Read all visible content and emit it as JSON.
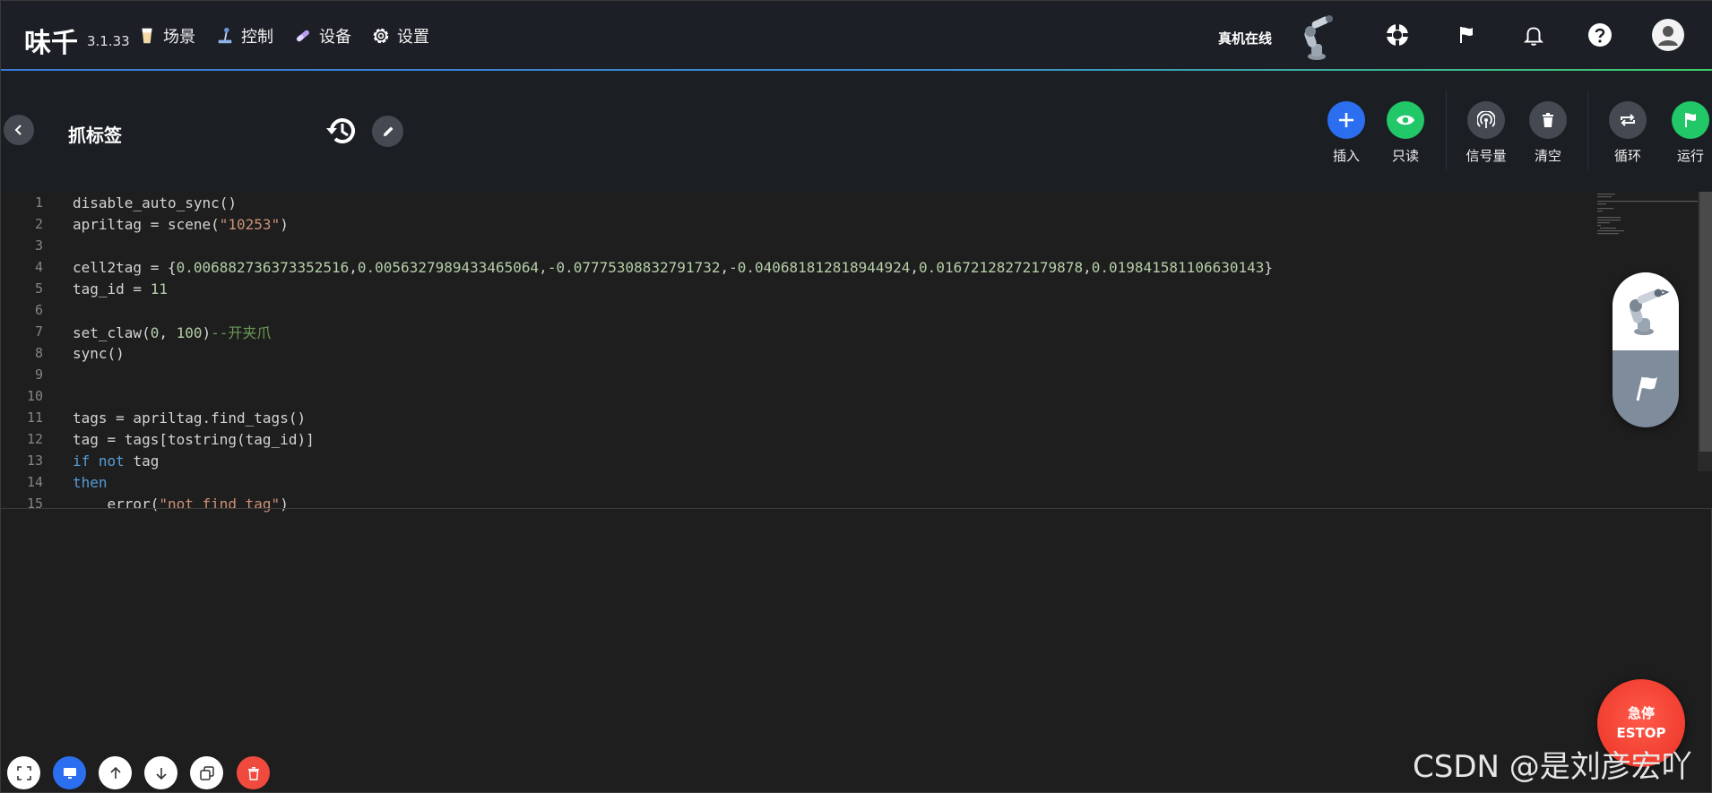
{
  "app": {
    "name": "味千",
    "version": "3.1.33"
  },
  "nav": [
    {
      "label": "场景",
      "icon": "cup-icon"
    },
    {
      "label": "控制",
      "icon": "joystick-icon"
    },
    {
      "label": "设备",
      "icon": "device-icon"
    },
    {
      "label": "设置",
      "icon": "gear-icon"
    }
  ],
  "status": {
    "text": "真机在线"
  },
  "file": {
    "title": "抓标签"
  },
  "toolbar": {
    "insert": "插入",
    "readonly": "只读",
    "signal": "信号量",
    "clear": "清空",
    "loop": "循环",
    "run": "运行"
  },
  "editor": {
    "lines": [
      {
        "n": "1"
      },
      {
        "n": "2"
      },
      {
        "n": "3"
      },
      {
        "n": "4"
      },
      {
        "n": "5"
      },
      {
        "n": "6"
      },
      {
        "n": "7"
      },
      {
        "n": "8"
      },
      {
        "n": "9"
      },
      {
        "n": "10"
      },
      {
        "n": "11"
      },
      {
        "n": "12"
      },
      {
        "n": "13"
      },
      {
        "n": "14"
      },
      {
        "n": "15"
      }
    ],
    "code": {
      "l1": "disable_auto_sync()",
      "l2a": "apriltag = scene(",
      "l2b": "\"10253\"",
      "l2c": ")",
      "l4a": "cell2tag = {",
      "l4b": "0.006882736373352516",
      "l4c": ",",
      "l4d": "0.005632798943346506",
      "l4e": "4,",
      "l4f": "-0.07775308832791732",
      "l4g": ",",
      "l4h": "-0.040681812818944924",
      "l4i": ",",
      "l4j": "0.01672128272179878",
      "l4k": ",",
      "l4l": "0.019841581106630143",
      "l4m": "}",
      "l5a": "tag_id = ",
      "l5b": "11",
      "l7a": "set_claw(",
      "l7b": "0",
      "l7c": ", ",
      "l7d": "100",
      "l7e": ")",
      "l7f": "--开夹爪",
      "l8": "sync()",
      "l11": "tags = apriltag.find_tags()",
      "l12": "tag = tags[tostring(tag_id)]",
      "l13a": "if",
      "l13b": " ",
      "l13c": "not",
      "l13d": " tag",
      "l14": "then",
      "l15a": "    error(",
      "l15b": "\"not find tag\"",
      "l15c": ")"
    }
  },
  "estop": {
    "line1": "急停",
    "line2": "ESTOP"
  },
  "watermark": "CSDN @是刘彦宏吖",
  "colors": {
    "accent_blue": "#2b6ff0",
    "accent_green": "#22c768",
    "estop_red": "#f03e30"
  }
}
